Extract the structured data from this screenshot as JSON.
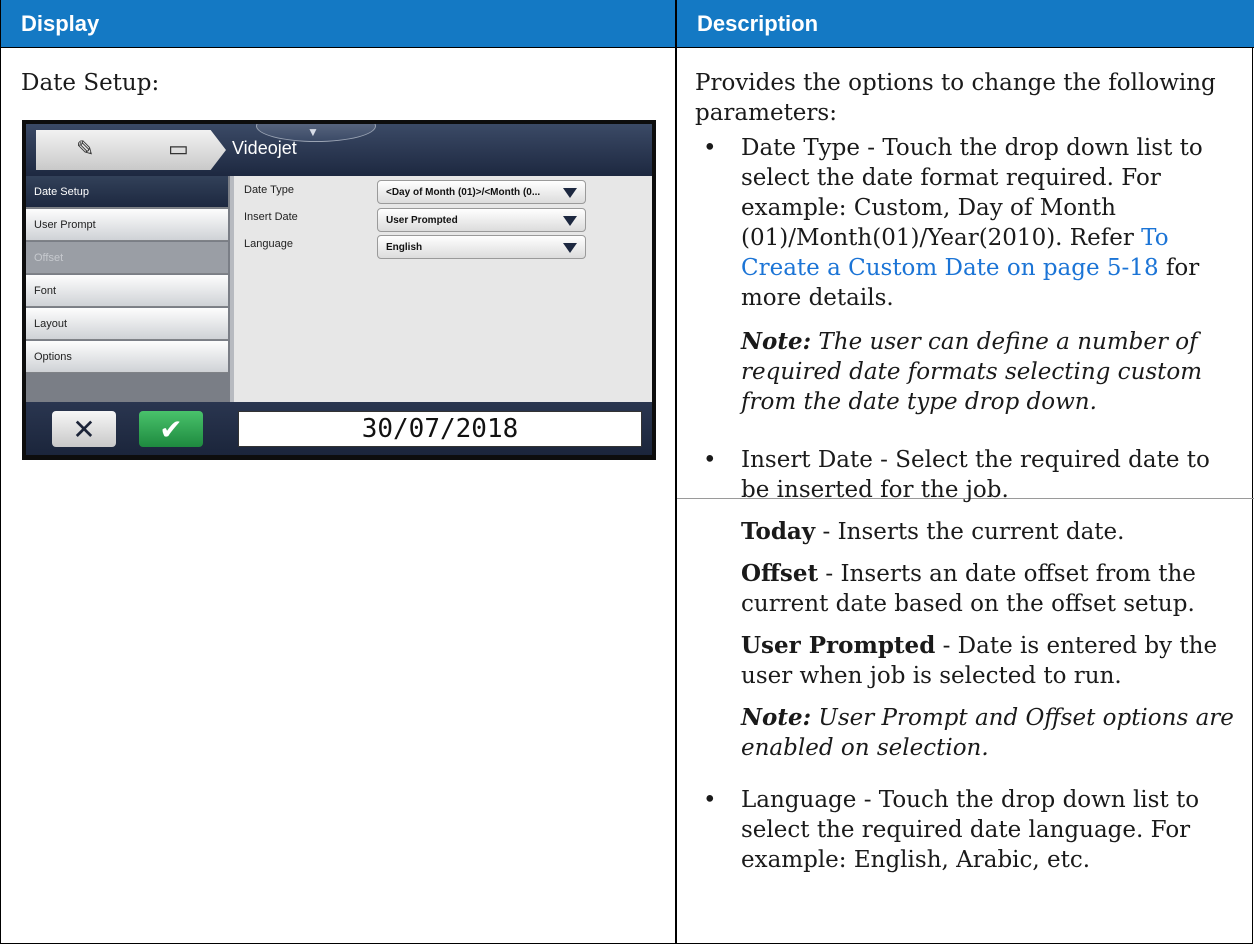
{
  "table": {
    "header_display": "Display",
    "header_description": "Description"
  },
  "display": {
    "label": "Date Setup:"
  },
  "device_screen": {
    "title": "Videojet",
    "breadcrumb_icons": [
      "edit-document-icon",
      "clipboard-icon"
    ],
    "sidebar": [
      {
        "label": "Date Setup",
        "state": "selected"
      },
      {
        "label": "User Prompt",
        "state": "normal"
      },
      {
        "label": "Offset",
        "state": "disabled"
      },
      {
        "label": "Font",
        "state": "normal"
      },
      {
        "label": "Layout",
        "state": "normal"
      },
      {
        "label": "Options",
        "state": "normal"
      }
    ],
    "fields": [
      {
        "label": "Date Type",
        "value": "<Day of Month (01)>/<Month (0..."
      },
      {
        "label": "Insert Date",
        "value": "User Prompted"
      },
      {
        "label": "Language",
        "value": "English"
      }
    ],
    "date_display": "30/07/2018",
    "cancel_icon": "close-icon",
    "ok_icon": "check-icon"
  },
  "description": {
    "intro": "Provides the options to change the following parameters:",
    "bullet1_text": "Date Type - Touch the drop down list to select the date format required. For example: Custom, Day of Month (01)/Month(01)/Year(2010). Refer ",
    "bullet1_link": "To Create a Custom Date on page 5-18",
    "bullet1_tail": " for more details.",
    "note1_label": "Note:",
    "note1_text": " The user can define a number of required date formats selecting custom from the date type drop down.",
    "bullet2_text": "Insert Date - Select the required date to be inserted for the job.",
    "today_term": "Today",
    "today_text": " - Inserts the current date.",
    "offset_term": "Offset",
    "offset_text": " - Inserts an date offset from the current date based on the offset setup.",
    "user_term": "User Prompted",
    "user_text": " - Date is entered by the user when job is selected to run.",
    "note2_label": "Note:",
    "note2_text": " User Prompt and Offset options are enabled on selection.",
    "bullet3_text": "Language - Touch the drop down list to select the required date language. For example: English, Arabic, etc.",
    "bullet_char": "•"
  }
}
